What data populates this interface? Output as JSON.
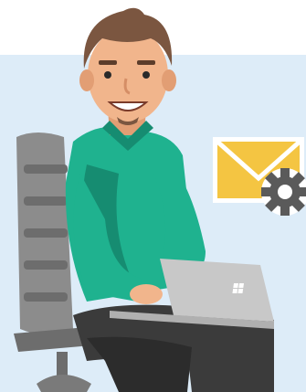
{
  "colors": {
    "background_top": "#ffffff",
    "background_panel": "#ddecf8",
    "shirt": "#1fb28f",
    "shirt_shadow": "#168c71",
    "skin": "#f1b58c",
    "hair": "#7b5640",
    "pants": "#3b3b3b",
    "chair": "#8c8c8c",
    "laptop": "#c8c8c8",
    "envelope": "#f4c542",
    "gear": "#5a5a5a"
  },
  "icons": [
    "envelope-icon",
    "gear-icon",
    "windows-logo-icon"
  ]
}
